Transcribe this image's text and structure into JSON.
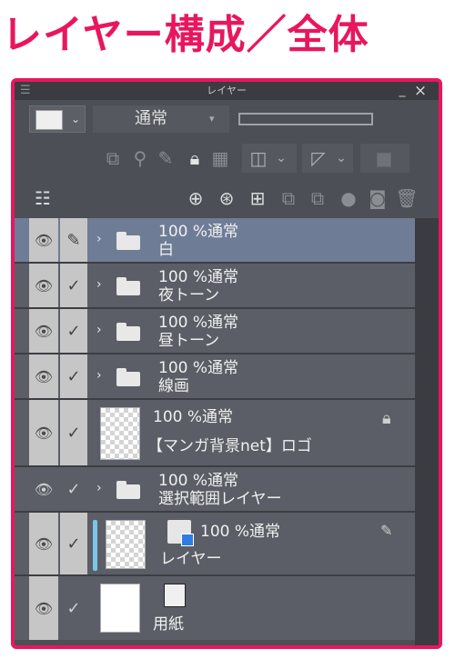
{
  "heading": "レイヤー構成／全体",
  "panel": {
    "title": "レイヤー",
    "minimize_label": "_",
    "close_label": "×",
    "blend_mode": "通常"
  },
  "layers": [
    {
      "opacity_mode": "100 %通常",
      "name": "白",
      "type": "folder",
      "selected": true
    },
    {
      "opacity_mode": "100 %通常",
      "name": "夜トーン",
      "type": "folder"
    },
    {
      "opacity_mode": "100 %通常",
      "name": "昼トーン",
      "type": "folder"
    },
    {
      "opacity_mode": "100 %通常",
      "name": "線画",
      "type": "folder"
    },
    {
      "opacity_mode": "100 %通常",
      "name": "【マンガ背景net】ロゴ",
      "type": "raster",
      "locked": true
    },
    {
      "opacity_mode": "100 %通常",
      "name": "選択範囲レイヤー",
      "type": "folder"
    },
    {
      "opacity_mode": "100 %通常",
      "name": "レイヤー",
      "type": "raster"
    },
    {
      "name": "用紙",
      "type": "paper"
    }
  ],
  "colors": {
    "accent": "#e8175d",
    "panel": "#4c4f56",
    "selected": "#6f7c96"
  }
}
